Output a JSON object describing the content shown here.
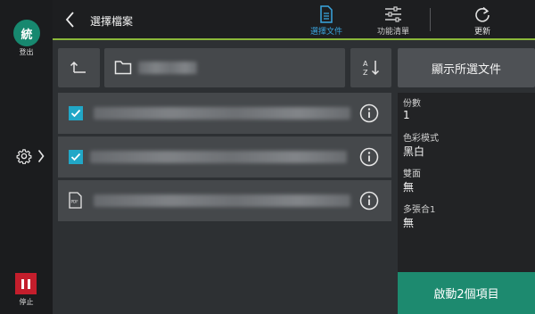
{
  "rail": {
    "avatar_text": "統",
    "logout_label": "登出",
    "stop_label": "停止"
  },
  "header": {
    "title": "選擇檔案",
    "buttons": [
      {
        "label": "選擇文件",
        "icon": "document-icon",
        "active": true
      },
      {
        "label": "功能清單",
        "icon": "sliders-icon",
        "active": false
      },
      {
        "label": "更新",
        "icon": "refresh-icon",
        "active": false
      }
    ],
    "accent_color": "#3aa6e0",
    "underline_color": "#8bb83a"
  },
  "toolbar": {
    "show_selected_label": "顯示所選文件"
  },
  "files": [
    {
      "selected": true,
      "icon": "checkbox-checked-icon"
    },
    {
      "selected": true,
      "icon": "checkbox-checked-icon"
    },
    {
      "selected": false,
      "icon": "pdf-icon",
      "icon_text": "PDF"
    }
  ],
  "settings": [
    {
      "label": "份數",
      "value": "1"
    },
    {
      "label": "色彩模式",
      "value": "黑白"
    },
    {
      "label": "雙面",
      "value": "無"
    },
    {
      "label": "多張合1",
      "value": "無"
    }
  ],
  "start_button": {
    "label": "啟動2個項目",
    "color": "#1d8a6f"
  }
}
